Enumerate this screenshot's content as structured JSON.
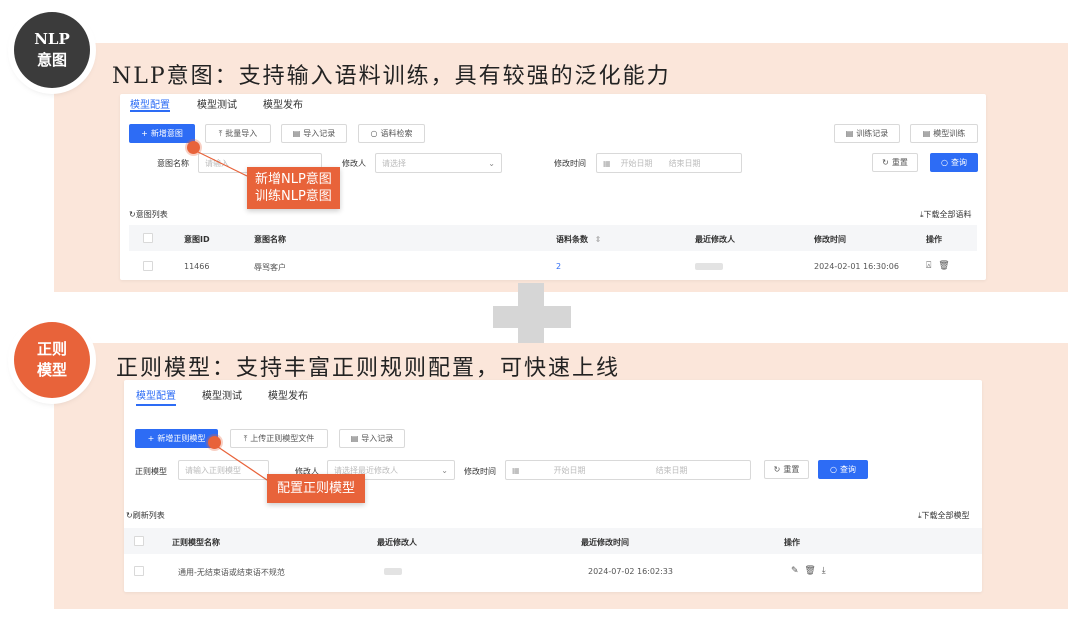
{
  "section1": {
    "badge_line1": "NLP",
    "badge_line2": "意图",
    "title": "NLP意图：支持输入语料训练，具有较强的泛化能力",
    "tabs": [
      "模型配置",
      "模型测试",
      "模型发布"
    ],
    "toolbar": {
      "add": "新增意图",
      "batch_import": "批量导入",
      "import_record": "导入记录",
      "corpus_search": "语料检索",
      "train_record": "训练记录",
      "model_train": "模型训练"
    },
    "filters": {
      "intent_name_label": "意图名称",
      "intent_name_placeholder": "请输入",
      "modifier_label": "修改人",
      "modifier_placeholder": "请选择",
      "modified_time_label": "修改时间",
      "start_date": "开始日期",
      "end_date": "结束日期",
      "reset": "重置",
      "query": "查询"
    },
    "list_title": "意图列表",
    "download_all": "下载全部语料",
    "columns": [
      "意图ID",
      "意图名称",
      "语料条数",
      "最近修改人",
      "修改时间",
      "操作"
    ],
    "rows": [
      {
        "id": "11466",
        "name": "辱骂客户",
        "count": "2",
        "modified_time": "2024-02-01 16:30:06"
      }
    ],
    "callout_line1": "新增NLP意图",
    "callout_line2": "训练NLP意图"
  },
  "section2": {
    "badge_line1": "正则",
    "badge_line2": "模型",
    "title": "正则模型：支持丰富正则规则配置，可快速上线",
    "tabs": [
      "模型配置",
      "模型测试",
      "模型发布"
    ],
    "toolbar": {
      "add": "新增正则模型",
      "upload": "上传正则模型文件",
      "import_record": "导入记录"
    },
    "filters": {
      "model_label": "正则模型",
      "model_placeholder": "请输入正则模型",
      "modifier_label": "修改人",
      "modifier_placeholder": "请选择最近修改人",
      "modified_time_label": "修改时间",
      "start_date": "开始日期",
      "end_date": "结束日期",
      "reset": "重置",
      "query": "查询"
    },
    "list_title": "刷新列表",
    "download_all": "下载全部模型",
    "columns": [
      "正则模型名称",
      "最近修改人",
      "最近修改时间",
      "操作"
    ],
    "rows": [
      {
        "name": "通用-无结束语或结束语不规范",
        "modified_time": "2024-07-02 16:02:33"
      }
    ],
    "callout": "配置正则模型"
  },
  "colors": {
    "accent": "#2d6cf5",
    "orange": "#e8633a",
    "panel": "#fbe6da",
    "dark": "#3b3b3b"
  },
  "icons": [
    "plus-icon",
    "upload-icon",
    "file-icon",
    "search-icon",
    "calendar-icon",
    "chevron-down-icon",
    "refresh-icon",
    "download-icon",
    "sort-icon",
    "edit-icon",
    "delete-icon",
    "lock-icon"
  ]
}
